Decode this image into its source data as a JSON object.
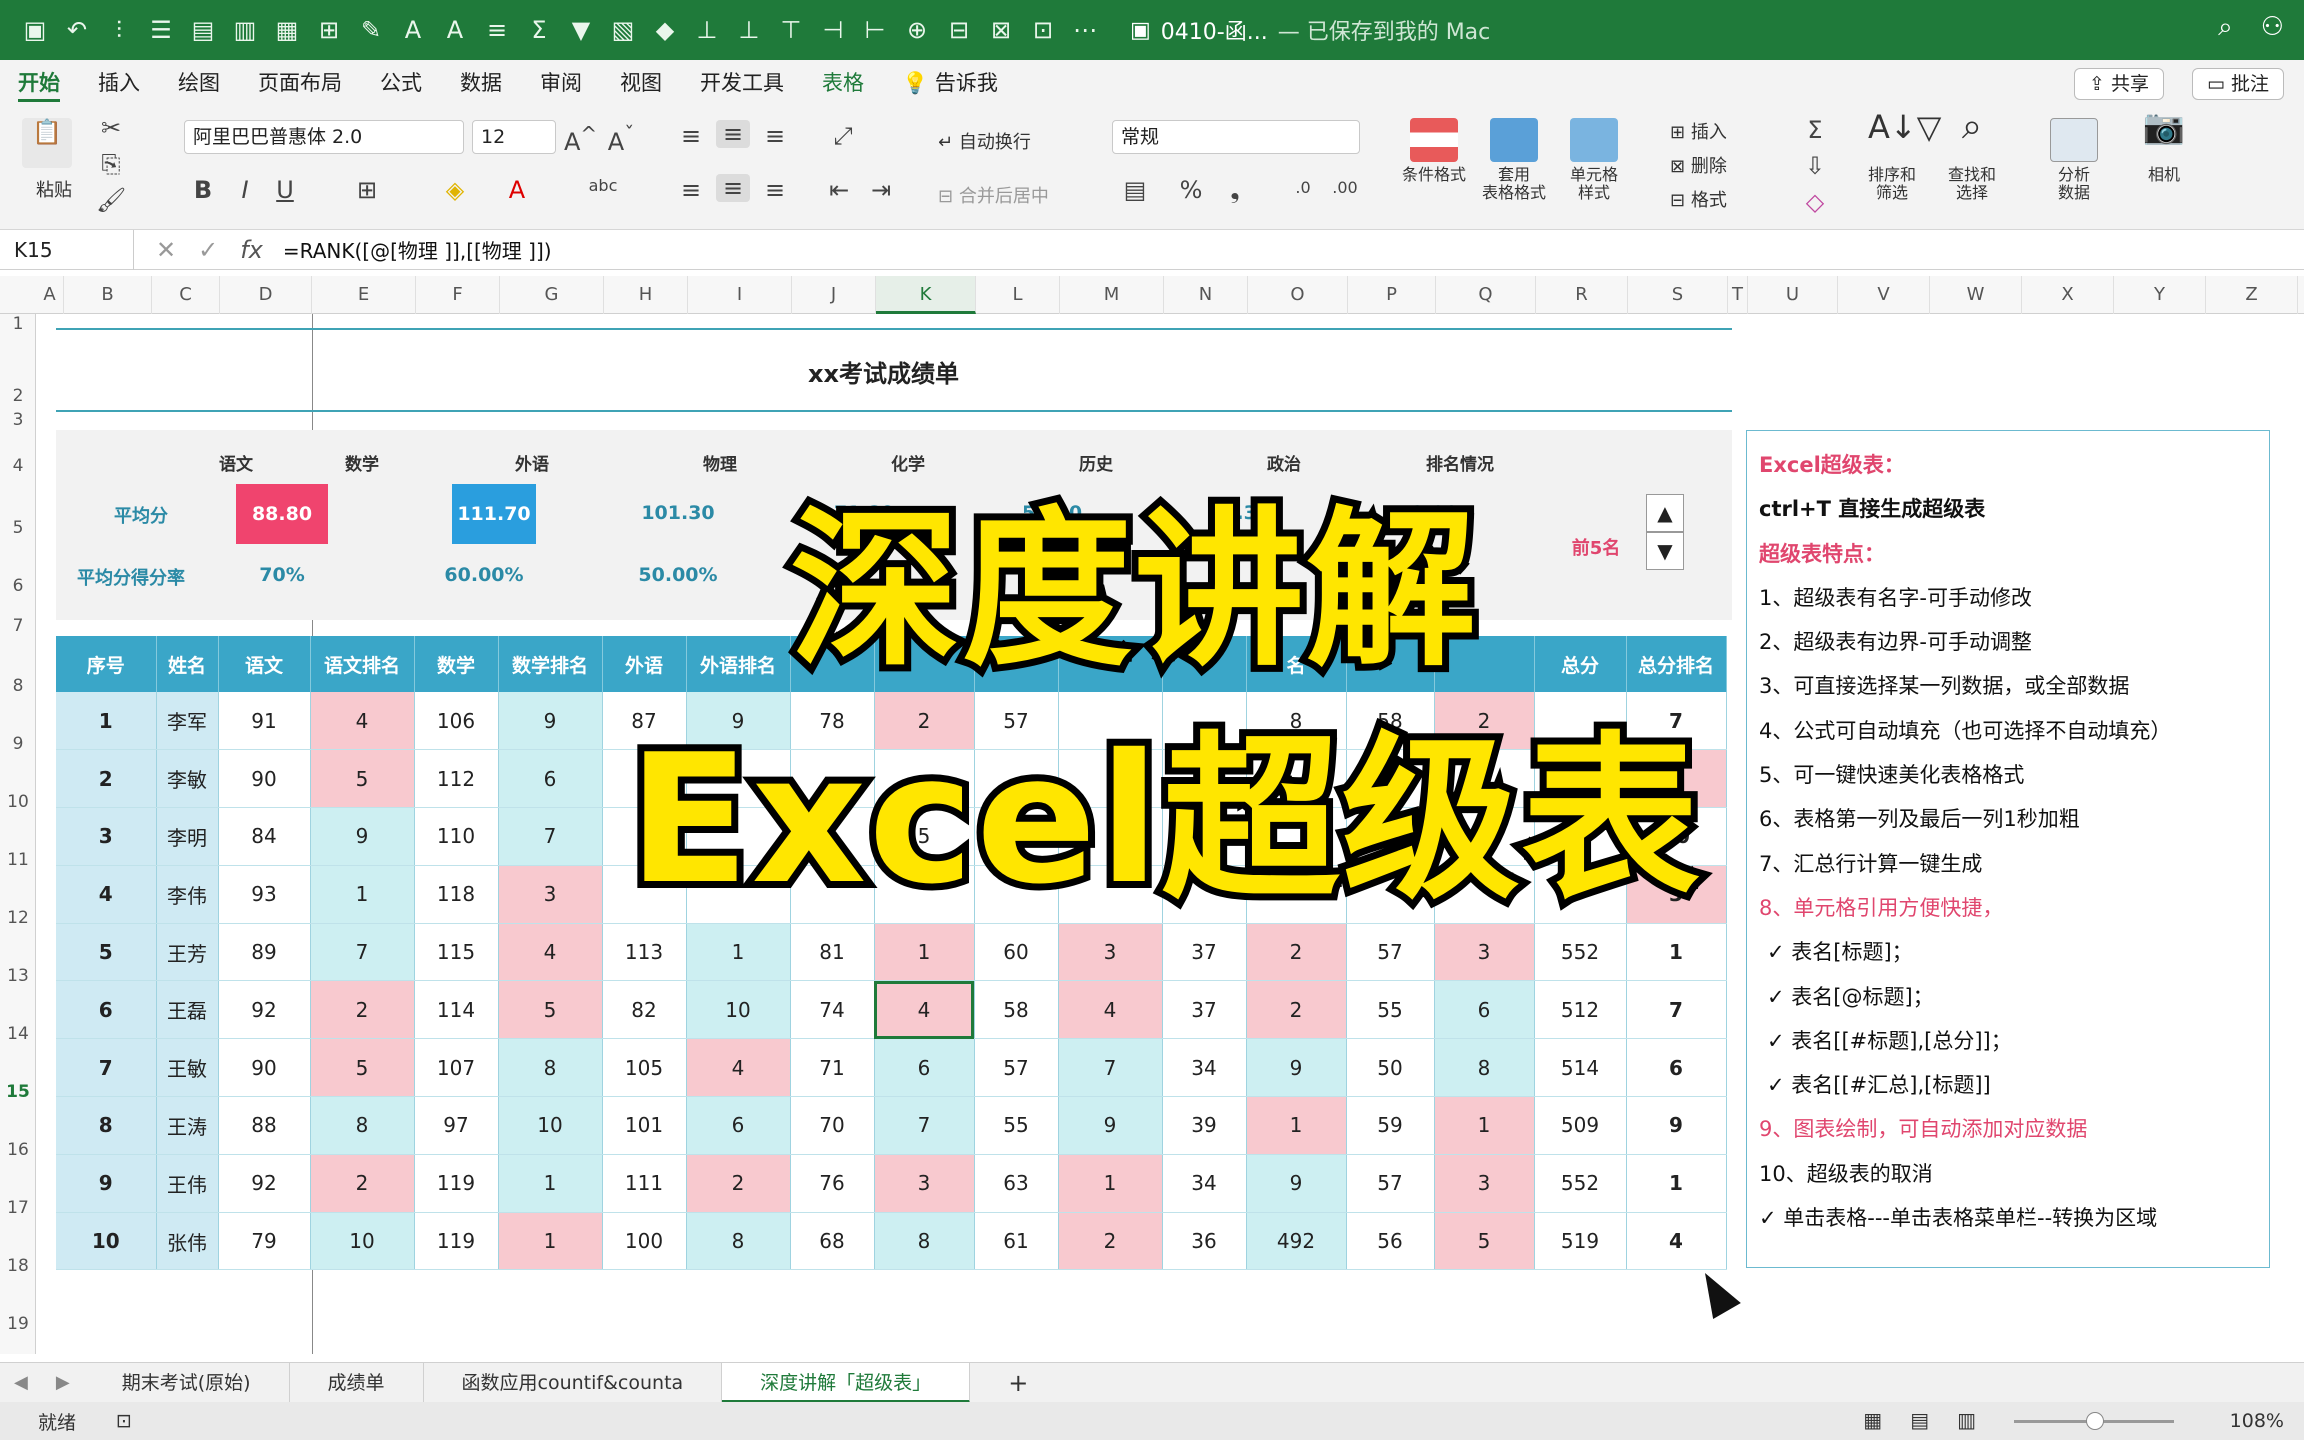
{
  "window": {
    "doc_title": "0410-函...",
    "save_status": "— 已保存到我的 Mac"
  },
  "menu_tabs": [
    "开始",
    "插入",
    "绘图",
    "页面布局",
    "公式",
    "数据",
    "审阅",
    "视图",
    "开发工具",
    "表格",
    "告诉我"
  ],
  "menu_actions": {
    "share": "共享",
    "comment": "批注"
  },
  "ribbon": {
    "paste": "粘贴",
    "font_name": "阿里巴巴普惠体 2.0",
    "font_size": "12",
    "wrap_text": "自动换行",
    "merge_center": "合并后居中",
    "number_format": "常规",
    "cond_format": "条件格式",
    "table_format": "套用\n表格格式",
    "cell_style": "单元格\n样式",
    "insert": "插入",
    "delete": "删除",
    "format": "格式",
    "sort_filter": "排序和\n筛选",
    "find_select": "查找和\n选择",
    "analyze": "分析\n数据",
    "camera": "相机"
  },
  "formula_bar": {
    "cell_ref": "K15",
    "formula": "=RANK([@[物理 ]],[[物理 ]])"
  },
  "columns": [
    "A",
    "B",
    "C",
    "D",
    "E",
    "F",
    "G",
    "H",
    "I",
    "J",
    "K",
    "L",
    "M",
    "N",
    "O",
    "P",
    "Q",
    "R",
    "S",
    "T",
    "U",
    "V",
    "W",
    "X",
    "Y",
    "Z"
  ],
  "rows": [
    "1",
    "2",
    "3",
    "4",
    "5",
    "6",
    "7",
    "8",
    "9",
    "10",
    "11",
    "12",
    "13",
    "14",
    "15",
    "16",
    "17",
    "18",
    "19",
    "20"
  ],
  "sheet_title": "xx考试成绩单",
  "summary": {
    "headers": [
      "语文",
      "数学",
      "外语",
      "物理",
      "化学",
      "历史",
      "政治",
      "排名情况"
    ],
    "avg_label": "平均分",
    "rate_label": "平均分得分率",
    "avg_values": [
      "88.80",
      "111.70",
      "101.30",
      "71.80",
      "58.00",
      "36.30",
      "52.90"
    ],
    "rate_values": [
      "70%",
      "60.00%",
      "50.00%"
    ],
    "rank_text": "前5名"
  },
  "table": {
    "headers": [
      "序号",
      "姓名",
      "语文",
      "语文排名",
      "数学",
      "数学排名",
      "外语",
      "外语排名",
      "",
      "",
      "",
      "",
      "",
      "名",
      "",
      "",
      "总分",
      "总分排名"
    ],
    "rows": [
      [
        "1",
        "李军",
        "91",
        "4",
        "106",
        "9",
        "87",
        "9",
        "78",
        "2",
        "57",
        "",
        "",
        "8",
        "58",
        "2",
        "",
        "7"
      ],
      [
        "2",
        "李敏",
        "90",
        "5",
        "112",
        "6",
        "",
        "",
        "",
        "",
        "",
        "",
        "",
        "",
        "",
        "",
        "",
        "5"
      ],
      [
        "3",
        "李明",
        "84",
        "9",
        "110",
        "7",
        "",
        "",
        "",
        "5",
        "",
        "",
        "",
        "",
        "",
        "",
        "",
        "10"
      ],
      [
        "4",
        "李伟",
        "93",
        "1",
        "118",
        "3",
        "",
        "",
        "",
        "",
        "",
        "",
        "",
        "",
        "",
        "",
        "",
        "3"
      ],
      [
        "5",
        "王芳",
        "89",
        "7",
        "115",
        "4",
        "113",
        "1",
        "81",
        "1",
        "60",
        "3",
        "37",
        "2",
        "57",
        "3",
        "552",
        "1"
      ],
      [
        "6",
        "王磊",
        "92",
        "2",
        "114",
        "5",
        "82",
        "10",
        "74",
        "4",
        "58",
        "4",
        "37",
        "2",
        "55",
        "6",
        "512",
        "7"
      ],
      [
        "7",
        "王敏",
        "90",
        "5",
        "107",
        "8",
        "105",
        "4",
        "71",
        "6",
        "57",
        "7",
        "34",
        "9",
        "50",
        "8",
        "514",
        "6"
      ],
      [
        "8",
        "王涛",
        "88",
        "8",
        "97",
        "10",
        "101",
        "6",
        "70",
        "7",
        "55",
        "9",
        "39",
        "1",
        "59",
        "1",
        "509",
        "9"
      ],
      [
        "9",
        "王伟",
        "92",
        "2",
        "119",
        "1",
        "111",
        "2",
        "76",
        "3",
        "63",
        "1",
        "34",
        "9",
        "57",
        "3",
        "552",
        "1"
      ],
      [
        "10",
        "张伟",
        "79",
        "10",
        "119",
        "1",
        "100",
        "8",
        "68",
        "8",
        "61",
        "2",
        "36",
        "492",
        "56",
        "5",
        "519",
        "4"
      ]
    ]
  },
  "notes": [
    {
      "text": "Excel超级表：",
      "style": "red"
    },
    {
      "text": "ctrl+T 直接生成超级表",
      "style": "bold"
    },
    {
      "text": "超级表特点：",
      "style": "red"
    },
    {
      "text": "1、超级表有名字-可手动修改",
      "style": ""
    },
    {
      "text": "2、超级表有边界-可手动调整",
      "style": ""
    },
    {
      "text": "3、可直接选择某一列数据，或全部数据",
      "style": ""
    },
    {
      "text": "4、公式可自动填充（也可选择不自动填充）",
      "style": ""
    },
    {
      "text": "5、可一键快速美化表格格式",
      "style": ""
    },
    {
      "text": "6、表格第一列及最后一列1秒加粗",
      "style": ""
    },
    {
      "text": "7、汇总行计算一键生成",
      "style": ""
    },
    {
      "text": "8、单元格引用方便快捷，",
      "style": "pink"
    },
    {
      "text": "✓    表名[标题]；",
      "style": "check"
    },
    {
      "text": "✓    表名[@标题]；",
      "style": "check"
    },
    {
      "text": "✓    表名[[#标题],[总分]]；",
      "style": "check"
    },
    {
      "text": "✓    表名[[#汇总],[标题]]",
      "style": "check"
    },
    {
      "text": "9、图表绘制，可自动添加对应数据",
      "style": "pink"
    },
    {
      "text": "10、超级表的取消",
      "style": ""
    },
    {
      "text": "✓  单击表格---单击表格菜单栏--转换为区域",
      "style": ""
    }
  ],
  "overlay": {
    "line1": "深度讲解",
    "line2": "Excel超级表"
  },
  "sheet_tabs": [
    "期末考试(原始)",
    "成绩单",
    "函数应用countif&counta",
    "深度讲解「超级表」",
    "+"
  ],
  "status": {
    "ready": "就绪",
    "zoom": "108%"
  },
  "colors": {
    "excel_green": "#1f7a3a",
    "table_header": "#3aa6c8",
    "pink": "#f8c9cf",
    "cyan": "#cdeff2",
    "overlay_yellow": "#ffe600"
  }
}
